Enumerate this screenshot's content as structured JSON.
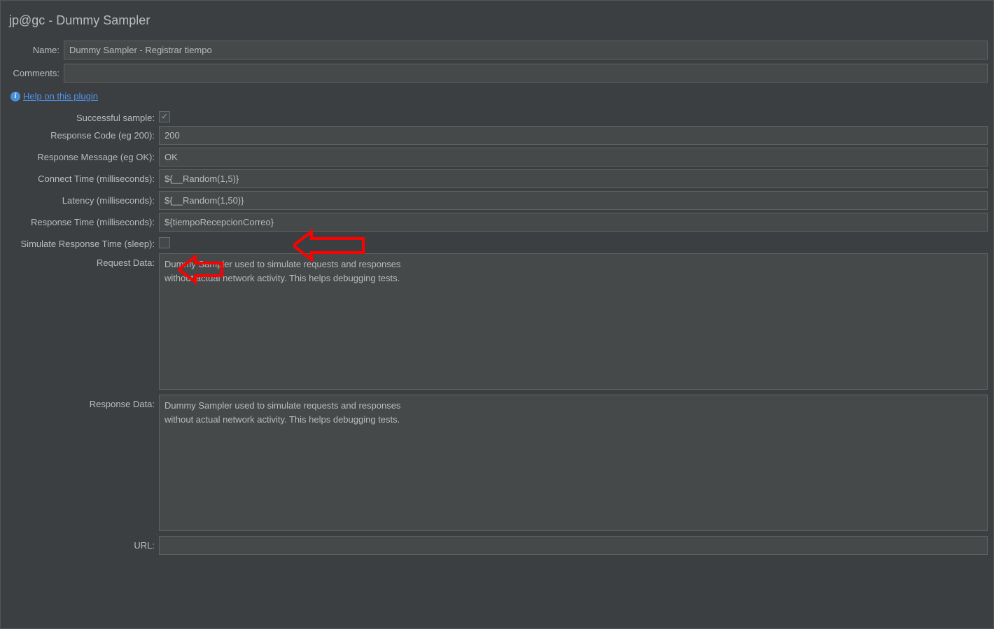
{
  "heading": "jp@gc - Dummy Sampler",
  "name": {
    "label": "Name:",
    "value": "Dummy Sampler - Registrar tiempo"
  },
  "comments": {
    "label": "Comments:",
    "value": ""
  },
  "help": {
    "text": "Help on this plugin"
  },
  "fields": {
    "successful_sample": {
      "label": "Successful sample:",
      "checked": true
    },
    "response_code": {
      "label": "Response Code (eg 200):",
      "value": "200"
    },
    "response_message": {
      "label": "Response Message (eg OK):",
      "value": "OK"
    },
    "connect_time": {
      "label": "Connect Time (milliseconds):",
      "value": "${__Random(1,5)}"
    },
    "latency": {
      "label": "Latency (milliseconds):",
      "value": "${__Random(1,50)}"
    },
    "response_time": {
      "label": "Response Time (milliseconds):",
      "value": "${tiempoRecepcionCorreo}"
    },
    "simulate_sleep": {
      "label": "Simulate Response Time (sleep):",
      "checked": false
    },
    "request_data": {
      "label": "Request Data:",
      "value": "Dummy Sampler used to simulate requests and responses\nwithout actual network activity. This helps debugging tests."
    },
    "response_data": {
      "label": "Response Data:",
      "value": "Dummy Sampler used to simulate requests and responses\nwithout actual network activity. This helps debugging tests."
    },
    "url": {
      "label": "URL:",
      "value": ""
    }
  }
}
